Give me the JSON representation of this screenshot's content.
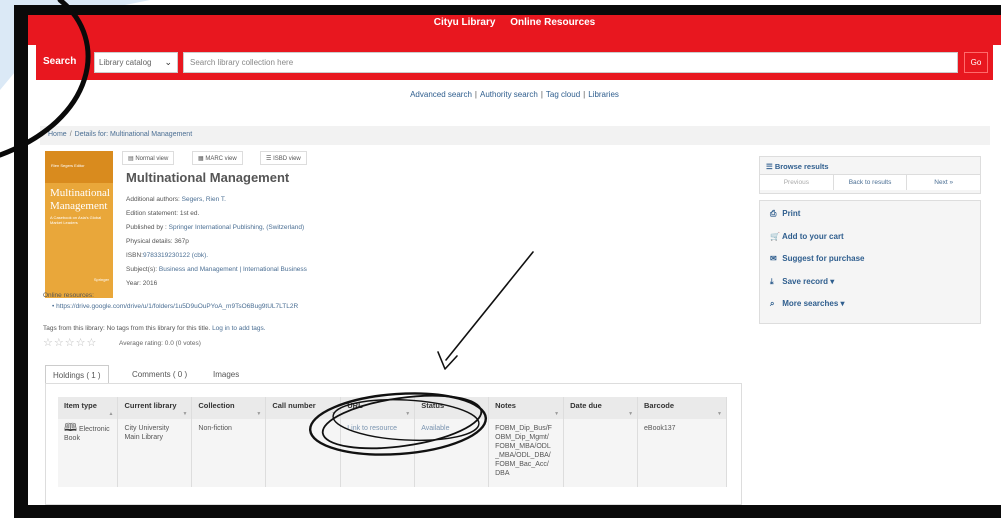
{
  "header": {
    "library_name": "Cityu Library",
    "online_resources": "Online Resources"
  },
  "search": {
    "label": "Search",
    "scope": "Library catalog",
    "placeholder": "Search library collection here",
    "go": "Go"
  },
  "links": {
    "advanced": "Advanced search",
    "authority": "Authority search",
    "tag_cloud": "Tag cloud",
    "libraries": "Libraries"
  },
  "breadcrumb": {
    "home": "Home",
    "current": "Details for: Multinational Management"
  },
  "cover": {
    "authors": "Rien Segers Editor",
    "title_line1": "Multinational",
    "title_line2": "Management",
    "subtitle": "A Casebook on Asia's Global Market Leaders",
    "publisher": "Springer"
  },
  "view_tabs": {
    "normal": "Normal view",
    "marc": "MARC view",
    "isbd": "ISBD view"
  },
  "record": {
    "title": "Multinational Management",
    "authors_label": "Additional authors:",
    "authors_value": "Segers, Rien T.",
    "edition": "Edition statement: 1st ed.",
    "published_label": "Published by :",
    "published_value": "Springer International Publishing, (Switzerland)",
    "physical": "Physical details: 367p",
    "isbn_label": "ISBN:",
    "isbn_value": "9783319230122 (cbk).",
    "subjects_label": "Subject(s):",
    "subjects_value": "Business and Management | International Business",
    "year": "Year: 2016"
  },
  "online": {
    "label": "Online resources:",
    "url": "https://drive.google.com/drive/u/1/folders/1u5D9uOuPYoA_m9TsO6Bug9tUL7LTL2R"
  },
  "tags": {
    "prefix": "Tags from this library: No tags from this library for this title.",
    "login": "Log in to add tags."
  },
  "rating": {
    "stars": "☆☆☆☆☆",
    "text": "Average rating: 0.0 (0 votes)"
  },
  "holdings_tabs": {
    "holdings": "Holdings ( 1 )",
    "comments": "Comments ( 0 )",
    "images": "Images"
  },
  "table": {
    "headers": [
      "Item type",
      "Current library",
      "Collection",
      "Call number",
      "URL",
      "Status",
      "Notes",
      "Date due",
      "Barcode"
    ],
    "row": {
      "item_type_1": "Electronic",
      "item_type_2": "Book",
      "library_1": "City University",
      "library_2": "Main Library",
      "collection": "Non-fiction",
      "call_number": "",
      "url": "Link to resource",
      "status": "Available",
      "notes_1": "FOBM_Dip_Bus/F",
      "notes_2": "OBM_Dip_Mgmt/",
      "notes_3": "FOBM_MBA/ODL",
      "notes_4": "_MBA/ODL_DBA/",
      "notes_5": "FOBM_Bac_Acc/",
      "notes_6": "DBA",
      "date_due": "",
      "barcode": "eBook137"
    }
  },
  "sidebar": {
    "browse": "Browse results",
    "previous": "Previous",
    "back": "Back to results",
    "next": "Next »",
    "print": "Print",
    "cart": "Add to your cart",
    "suggest": "Suggest for purchase",
    "save": "Save record",
    "more": "More searches"
  },
  "colors": {
    "brand_red": "#e8171f",
    "link_blue": "#2f5e8e",
    "annotation_black": "#0a0a0a"
  }
}
